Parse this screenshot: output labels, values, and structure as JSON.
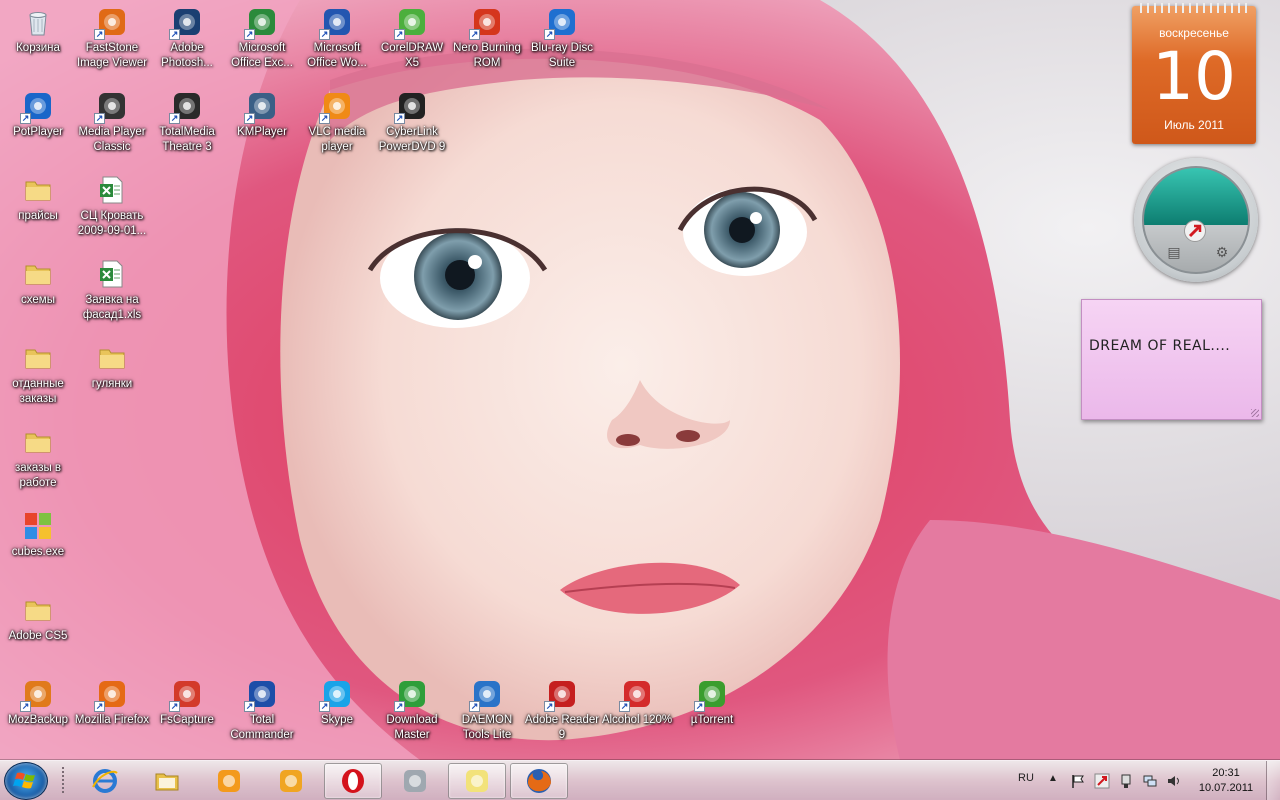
{
  "desktop": {
    "icons": [
      {
        "label": "Корзина",
        "icon": "recycle-bin-icon",
        "color": "#9aa7b4"
      },
      {
        "label": "FastStone Image Viewer",
        "icon": "faststone-icon",
        "color": "#e06a16"
      },
      {
        "label": "Adobe Photosh...",
        "icon": "photoshop-icon",
        "color": "#1b3f72"
      },
      {
        "label": "Microsoft Office Exc...",
        "icon": "excel-icon",
        "color": "#2b8a3b"
      },
      {
        "label": "Microsoft Office Wo...",
        "icon": "word-icon",
        "color": "#2356b0"
      },
      {
        "label": "CorelDRAW X5",
        "icon": "coreldraw-icon",
        "color": "#4caf3d"
      },
      {
        "label": "Nero Burning ROM",
        "icon": "nero-icon",
        "color": "#d5361d"
      },
      {
        "label": "Blu-ray Disc Suite",
        "icon": "bluray-icon",
        "color": "#1f6fd0"
      },
      {
        "label": "PotPlayer",
        "icon": "potplayer-icon",
        "color": "#1a66c9"
      },
      {
        "label": "Media Player Classic",
        "icon": "mpc-icon",
        "color": "#333333"
      },
      {
        "label": "TotalMedia Theatre 3",
        "icon": "totalmedia-icon",
        "color": "#2a2a2a"
      },
      {
        "label": "KMPlayer",
        "icon": "kmplayer-icon",
        "color": "#3a5f86"
      },
      {
        "label": "VLC media player",
        "icon": "vlc-icon",
        "color": "#f08a16"
      },
      {
        "label": "CyberLink PowerDVD 9",
        "icon": "powerdvd-icon",
        "color": "#222222"
      },
      {
        "label": "прайсы",
        "icon": "folder-icon",
        "color": "#e9c45a"
      },
      {
        "label": "СЦ Кровать 2009-09-01...",
        "icon": "excel-file-icon",
        "color": "#2b8a3b"
      },
      {
        "label": "схемы",
        "icon": "folder-icon",
        "color": "#e9c45a"
      },
      {
        "label": "Заявка на фасад1.xls",
        "icon": "excel-file-icon",
        "color": "#2b8a3b"
      },
      {
        "label": "отданные заказы",
        "icon": "folder-icon",
        "color": "#e9c45a"
      },
      {
        "label": "гулянки",
        "icon": "folder-icon",
        "color": "#e9c45a"
      },
      {
        "label": "заказы в работе",
        "icon": "folder-icon",
        "color": "#e9c45a"
      },
      {
        "label": "cubes.exe",
        "icon": "cubes-icon",
        "color": "#e8442b"
      },
      {
        "label": "Adobe CS5",
        "icon": "folder-icon",
        "color": "#e9c45a"
      },
      {
        "label": "MozBackup",
        "icon": "mozbackup-icon",
        "color": "#e07a1b"
      },
      {
        "label": "Mozilla Firefox",
        "icon": "firefox-icon",
        "color": "#e56a15"
      },
      {
        "label": "FsCapture",
        "icon": "fscapture-icon",
        "color": "#d33a2a"
      },
      {
        "label": "Total Commander",
        "icon": "total-commander-icon",
        "color": "#1c4ea8"
      },
      {
        "label": "Skype",
        "icon": "skype-icon",
        "color": "#19a3e8"
      },
      {
        "label": "Download Master",
        "icon": "download-master-icon",
        "color": "#2f9e3a"
      },
      {
        "label": "DAEMON Tools Lite",
        "icon": "daemon-tools-icon",
        "color": "#2a73c8"
      },
      {
        "label": "Adobe Reader 9",
        "icon": "adobe-reader-icon",
        "color": "#c51f1f"
      },
      {
        "label": "Alcohol 120%",
        "icon": "alcohol-icon",
        "color": "#d42b2b"
      },
      {
        "label": "µTorrent",
        "icon": "utorrent-icon",
        "color": "#3a9d2e"
      }
    ]
  },
  "gadgets": {
    "calendar": {
      "day_of_week": "воскресенье",
      "day": "10",
      "month_year": "Июль 2011"
    },
    "kaspersky": {
      "icon": "kaspersky-icon",
      "left_icon": "report-icon",
      "right_icon": "settings-gear-icon"
    },
    "sticky_note": {
      "text": "DREAM OF REAL...."
    }
  },
  "taskbar": {
    "buttons": [
      {
        "name": "internet-explorer-icon",
        "active": false
      },
      {
        "name": "windows-explorer-icon",
        "active": false
      },
      {
        "name": "media-player-icon",
        "active": false
      },
      {
        "name": "winamp-icon",
        "active": false
      },
      {
        "name": "opera-icon",
        "active": true
      },
      {
        "name": "screenshot-tool-icon",
        "active": false
      },
      {
        "name": "sticky-notes-icon",
        "active": true
      },
      {
        "name": "firefox-icon",
        "active": true
      }
    ],
    "tray": {
      "language": "RU",
      "time": "20:31",
      "date": "10.07.2011"
    }
  }
}
